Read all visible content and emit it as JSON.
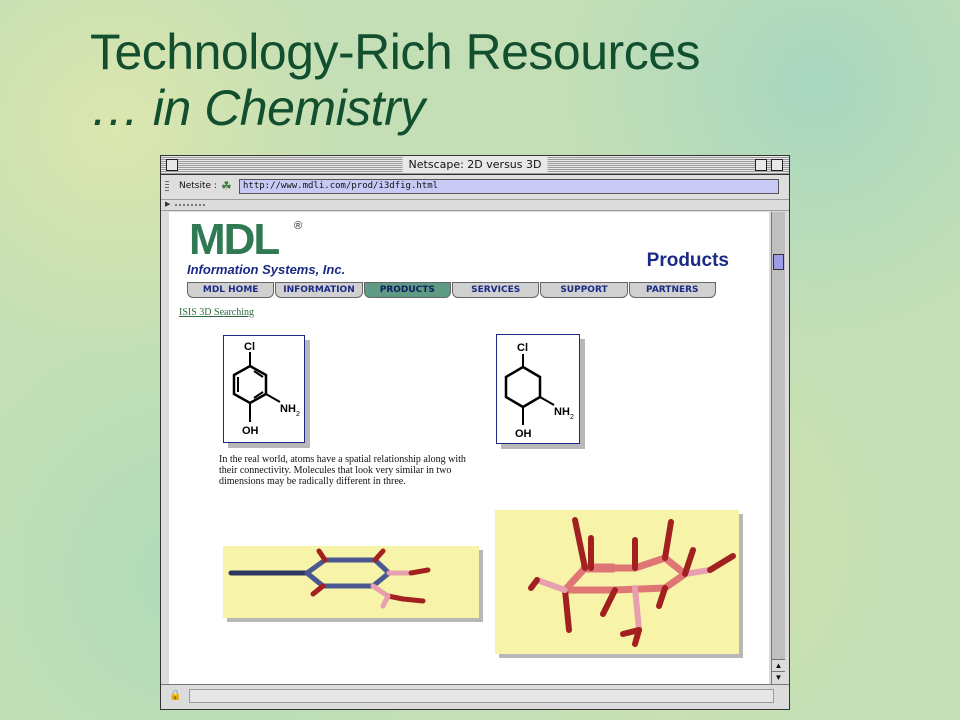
{
  "slide": {
    "title_line1": "Technology-Rich Resources",
    "title_line2": "… in Chemistry"
  },
  "window": {
    "title": "Netscape: 2D versus 3D",
    "netsite_label": "Netsite :",
    "url": "http://www.mdli.com/prod/i3dfig.html"
  },
  "page": {
    "logo": "MDL",
    "logo_registered": "®",
    "company": "Information Systems, Inc.",
    "section_heading": "Products",
    "nav": [
      {
        "label": "MDL HOME",
        "active": false
      },
      {
        "label": "INFORMATION",
        "active": false
      },
      {
        "label": "PRODUCTS",
        "active": true
      },
      {
        "label": "SERVICES",
        "active": false
      },
      {
        "label": "SUPPORT",
        "active": false
      },
      {
        "label": "PARTNERS",
        "active": false
      }
    ],
    "link": "ISIS 3D Searching",
    "structure_left": {
      "top_label": "Cl",
      "right_label": "NH",
      "right_sub": "2",
      "bottom_label": "OH"
    },
    "structure_right": {
      "top_label": "Cl",
      "right_label": "NH",
      "right_sub": "2",
      "bottom_label": "OH"
    },
    "paragraph": "In the real world, atoms have a spatial relationship along with their connectivity. Molecules that look very similar in two dimensions may be radically different in three."
  },
  "colors": {
    "title_green": "#124f2f",
    "logo_green": "#2f7a52",
    "brand_blue": "#1b2a84",
    "url_field": "#c9c9f5",
    "render_bg": "#f7f3a8"
  },
  "icons": {
    "proxy": "netsite-proxy-icon",
    "security": "lock-icon"
  }
}
